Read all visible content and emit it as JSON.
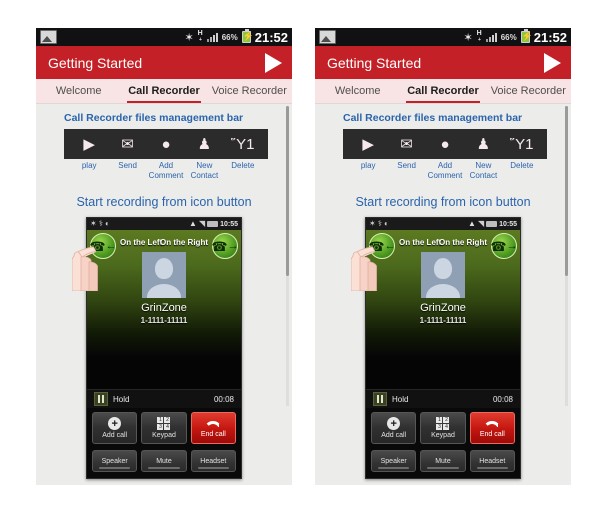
{
  "panels": [
    {
      "status_bar": {
        "picture_icon": "picture-icon",
        "bluetooth_icon": "✶",
        "network_main": "H",
        "network_sub": "+",
        "battery_pct": "66%",
        "clock": "21:52"
      },
      "appbar": {
        "title": "Getting Started",
        "next_icon": "next-arrow-icon"
      },
      "tabs": [
        {
          "label": "Welcome",
          "active": false
        },
        {
          "label": "Call Recorder",
          "active": true
        },
        {
          "label": "Voice Recorder",
          "active": false
        }
      ],
      "content": {
        "mgmt_label": "Call Recorder files management bar",
        "mgmt_buttons": [
          {
            "icon": "▶",
            "label": "play",
            "name": "play"
          },
          {
            "icon": "✉",
            "label": "Send",
            "name": "send"
          },
          {
            "icon": "●",
            "label": "Add Comment",
            "name": "add-comment"
          },
          {
            "icon": "♟",
            "label": "New Contact",
            "name": "new-contact"
          },
          {
            "icon": "Ὕ1",
            "label": "Delete",
            "name": "delete"
          }
        ],
        "section_head": "Start recording from icon button",
        "phone": {
          "status": {
            "clock": "10:55"
          },
          "left_label": "On the Left",
          "right_label": "On the Right",
          "left_arrow": "←",
          "right_arrow": "→",
          "callee_name": "GrinZone",
          "callee_number": "1-1111-11111",
          "hold_label": "Hold",
          "timer": "00:08",
          "keys": [
            {
              "label": "Add call",
              "name": "add-call"
            },
            {
              "label": "Keypad",
              "name": "keypad"
            },
            {
              "label": "End call",
              "name": "end-call"
            }
          ],
          "keys2": [
            {
              "label": "Speaker",
              "name": "speaker"
            },
            {
              "label": "Mute",
              "name": "mute"
            },
            {
              "label": "Headset",
              "name": "headset"
            }
          ],
          "keypad_digits": [
            "1",
            "2",
            "3",
            "4"
          ],
          "plus_icon": "+"
        }
      }
    },
    {
      "status_bar": {
        "picture_icon": "picture-icon",
        "bluetooth_icon": "✶",
        "network_main": "H",
        "network_sub": "+",
        "battery_pct": "66%",
        "clock": "21:52"
      },
      "appbar": {
        "title": "Getting Started",
        "next_icon": "next-arrow-icon"
      },
      "tabs": [
        {
          "label": "Welcome",
          "active": false
        },
        {
          "label": "Call Recorder",
          "active": true
        },
        {
          "label": "Voice Recorder",
          "active": false
        }
      ],
      "content": {
        "mgmt_label": "Call Recorder files management bar",
        "mgmt_buttons": [
          {
            "icon": "▶",
            "label": "play",
            "name": "play"
          },
          {
            "icon": "✉",
            "label": "Send",
            "name": "send"
          },
          {
            "icon": "●",
            "label": "Add Comment",
            "name": "add-comment"
          },
          {
            "icon": "♟",
            "label": "New Contact",
            "name": "new-contact"
          },
          {
            "icon": "Ὕ1",
            "label": "Delete",
            "name": "delete"
          }
        ],
        "section_head": "Start recording from icon button",
        "phone": {
          "status": {
            "clock": "10:55"
          },
          "left_label": "On the Left",
          "right_label": "On the Right",
          "left_arrow": "←",
          "right_arrow": "→",
          "callee_name": "GrinZone",
          "callee_number": "1-1111-11111",
          "hold_label": "Hold",
          "timer": "00:08",
          "keys": [
            {
              "label": "Add call",
              "name": "add-call"
            },
            {
              "label": "Keypad",
              "name": "keypad"
            },
            {
              "label": "End call",
              "name": "end-call"
            }
          ],
          "keys2": [
            {
              "label": "Speaker",
              "name": "speaker"
            },
            {
              "label": "Mute",
              "name": "mute"
            },
            {
              "label": "Headset",
              "name": "headset"
            }
          ],
          "keypad_digits": [
            "1",
            "2",
            "3",
            "4"
          ],
          "plus_icon": "+"
        }
      }
    }
  ],
  "colors": {
    "brand_red": "#c32127",
    "link_blue": "#2a64ad",
    "tab_bg": "#f9e4e5",
    "page_bg": "#ececea",
    "end_call_red": "#c3150f",
    "battery_green": "#8ec63f"
  }
}
